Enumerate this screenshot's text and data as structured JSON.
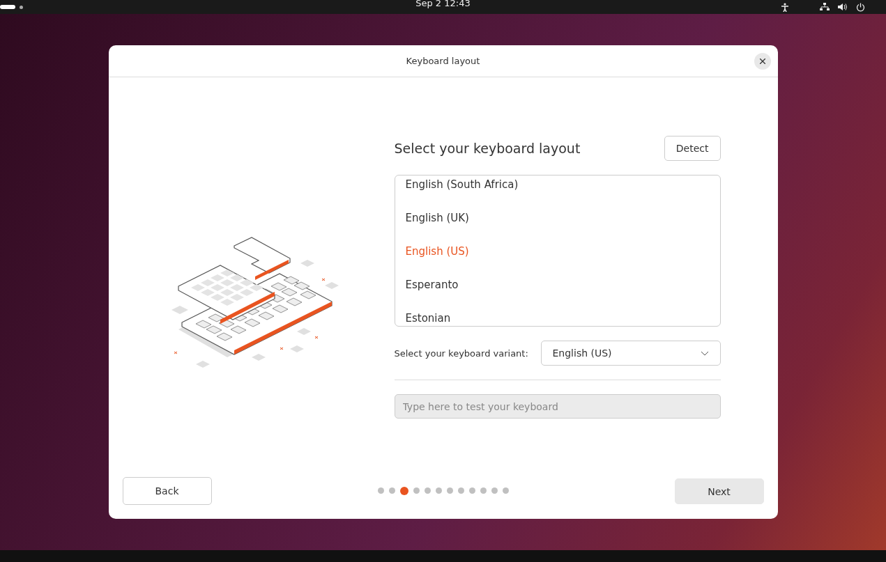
{
  "top_bar": {
    "clock": "Sep 2  12:43"
  },
  "window": {
    "title": "Keyboard layout"
  },
  "heading": "Select your keyboard layout",
  "detect_button": "Detect",
  "layouts": [
    {
      "label": "English (South Africa)",
      "selected": false
    },
    {
      "label": "English (UK)",
      "selected": false
    },
    {
      "label": "English (US)",
      "selected": true
    },
    {
      "label": "Esperanto",
      "selected": false
    },
    {
      "label": "Estonian",
      "selected": false
    }
  ],
  "variant": {
    "label": "Select your keyboard variant:",
    "value": "English (US)"
  },
  "test_field": {
    "placeholder": "Type here to test your keyboard"
  },
  "back_button": "Back",
  "next_button": "Next",
  "steps": [
    {
      "selected": false
    },
    {
      "selected": false
    },
    {
      "selected": true
    },
    {
      "selected": false
    },
    {
      "selected": false
    },
    {
      "selected": false
    },
    {
      "selected": false
    },
    {
      "selected": false
    },
    {
      "selected": false
    },
    {
      "selected": false
    },
    {
      "selected": false
    },
    {
      "selected": false
    }
  ]
}
